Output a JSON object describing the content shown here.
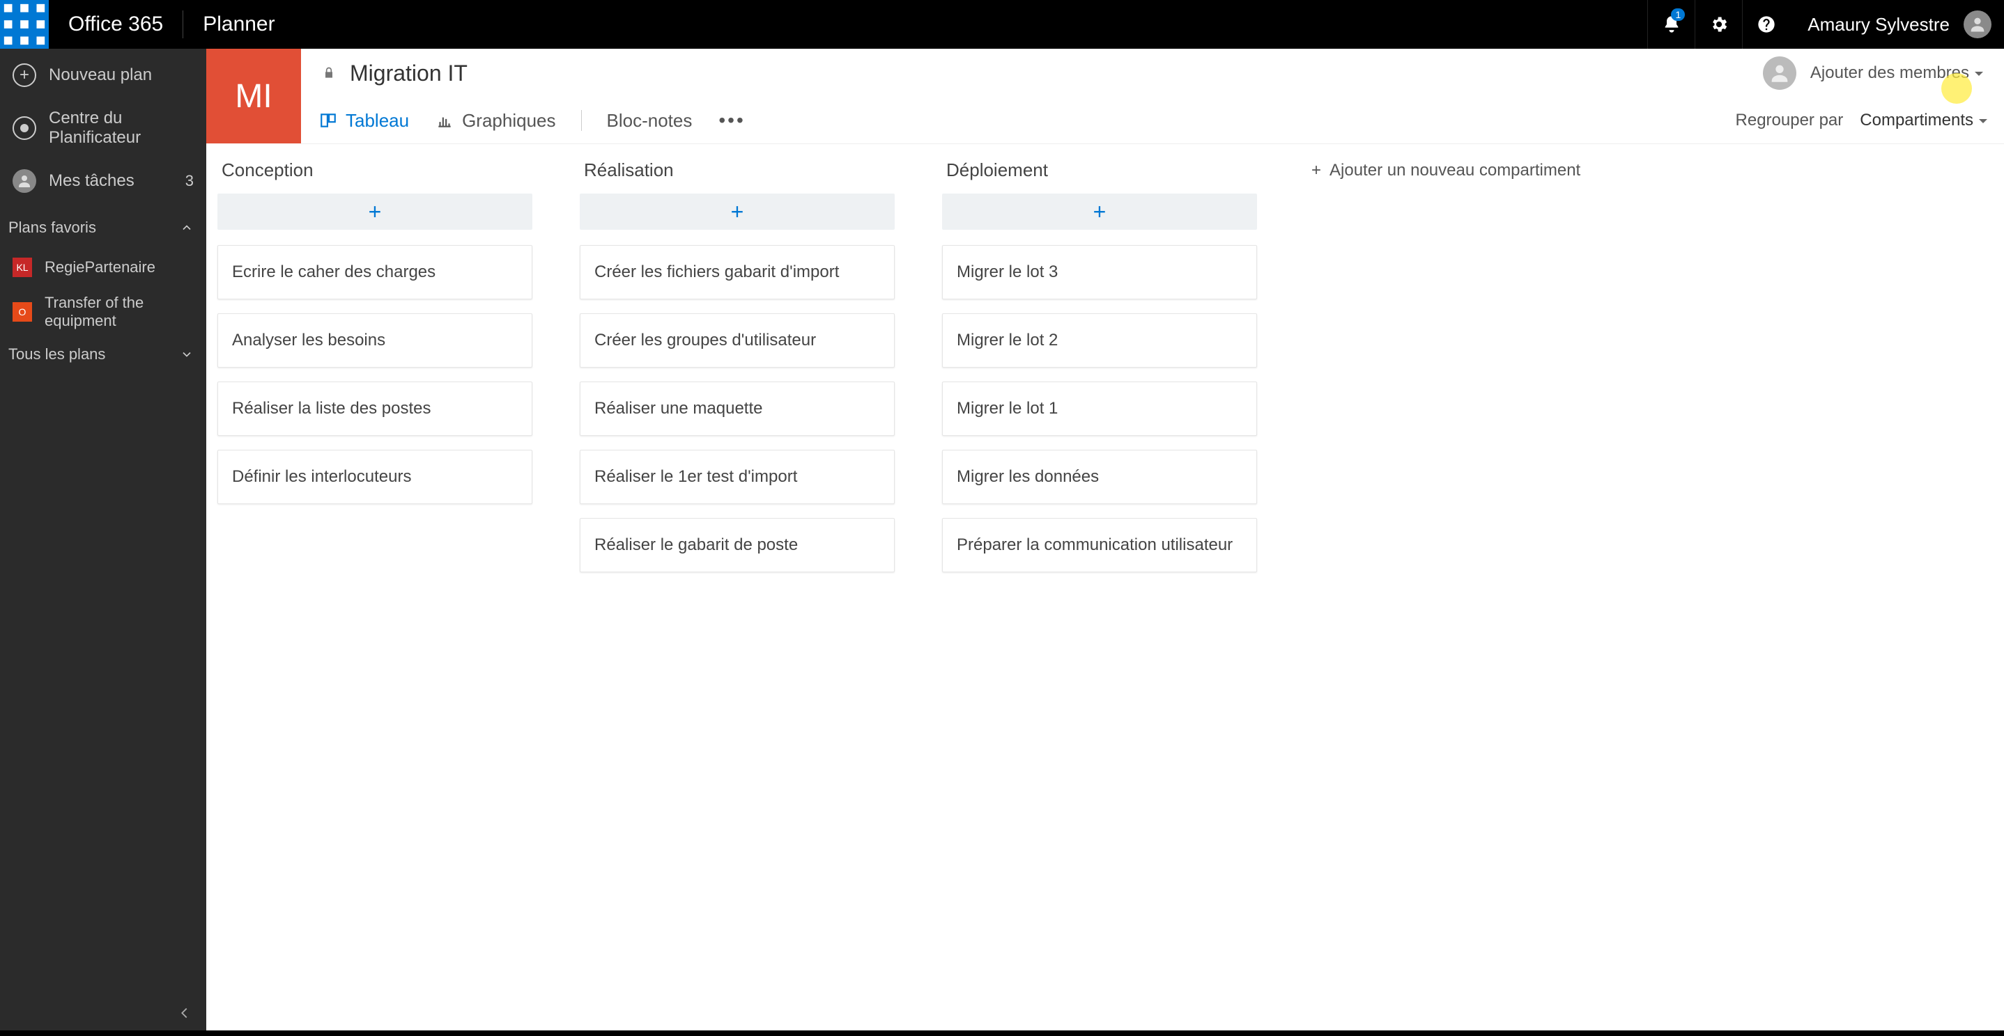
{
  "topbar": {
    "product": "Office 365",
    "app": "Planner",
    "notification_count": "1",
    "username": "Amaury Sylvestre"
  },
  "sidebar": {
    "new_plan": "Nouveau plan",
    "hub": "Centre du Planificateur",
    "my_tasks": "Mes tâches",
    "my_tasks_count": "3",
    "favorites_label": "Plans favoris",
    "favorites": [
      {
        "initials": "KL",
        "name": "RegiePartenaire",
        "color": "red"
      },
      {
        "initials": "O",
        "name": "Transfer of the equipment",
        "color": "orange"
      }
    ],
    "all_plans_label": "Tous les plans"
  },
  "plan": {
    "initials": "MI",
    "name": "Migration IT",
    "add_members_label": "Ajouter des membres",
    "group_by_label": "Regrouper par",
    "group_by_value": "Compartiments"
  },
  "tabs": {
    "board": "Tableau",
    "charts": "Graphiques",
    "notebook": "Bloc-notes"
  },
  "board": {
    "add_bucket_label": "Ajouter un nouveau compartiment",
    "buckets": [
      {
        "name": "Conception",
        "cards": [
          "Ecrire le caher des charges",
          "Analyser les besoins",
          "Réaliser la liste des postes",
          "Définir les interlocuteurs"
        ]
      },
      {
        "name": "Réalisation",
        "cards": [
          "Créer les fichiers gabarit d'import",
          "Créer les groupes d'utilisateur",
          "Réaliser une maquette",
          "Réaliser le 1er test d'import",
          "Réaliser le gabarit de poste"
        ]
      },
      {
        "name": "Déploiement",
        "cards": [
          "Migrer le lot 3",
          "Migrer le lot 2",
          "Migrer le lot 1",
          "Migrer les données",
          "Préparer la communication utilisateur"
        ]
      }
    ]
  }
}
